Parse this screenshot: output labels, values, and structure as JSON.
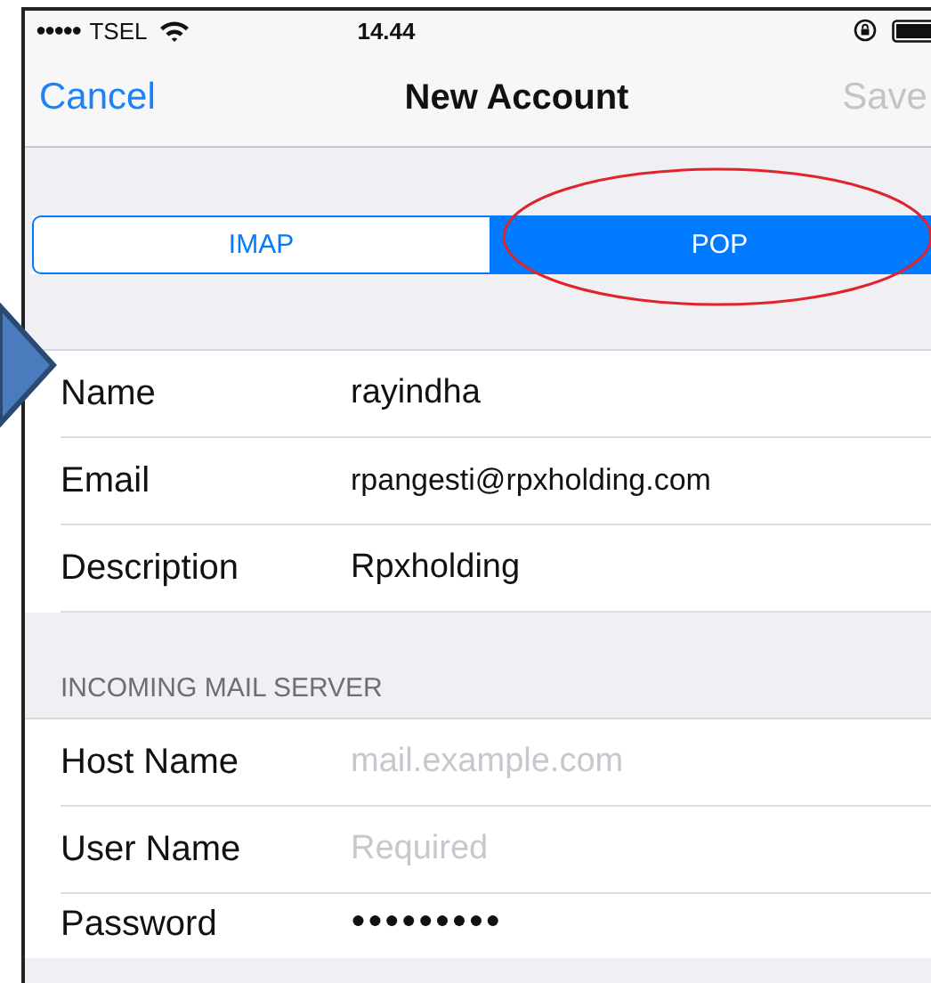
{
  "status_bar": {
    "signal_dots": "●●●●●",
    "carrier": "TSEL",
    "time": "14.44"
  },
  "nav_bar": {
    "cancel": "Cancel",
    "title": "New Account",
    "save": "Save",
    "save_disabled": true
  },
  "account_type": [
    {
      "label": "IMAP",
      "selected": false
    },
    {
      "label": "POP",
      "selected": true
    }
  ],
  "account_fields": [
    {
      "label": "Name",
      "value": "rayindha"
    },
    {
      "label": "Email",
      "value": "rpangesti@rpxholding.com"
    },
    {
      "label": "Description",
      "value": "Rpxholding"
    }
  ],
  "incoming_mail_server": {
    "header": "INCOMING MAIL SERVER",
    "fields": [
      {
        "label": "Host Name",
        "placeholder": "mail.example.com"
      },
      {
        "label": "User Name",
        "placeholder": "Required"
      },
      {
        "label": "Password",
        "value": "●●●●●●●●●",
        "kind": "password"
      }
    ]
  }
}
